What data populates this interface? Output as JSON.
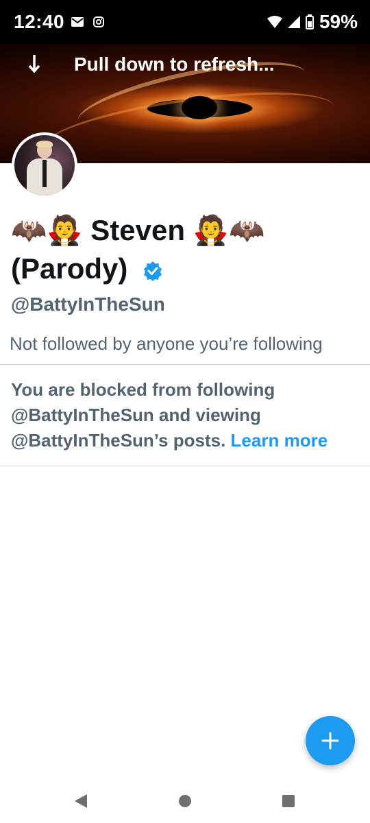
{
  "status_bar": {
    "time": "12:40",
    "battery_percent": "59%",
    "icons": [
      "mail-icon",
      "instagram-icon",
      "wifi-icon",
      "signal-icon",
      "battery-icon"
    ]
  },
  "banner": {
    "refresh_text": "Pull down to refresh..."
  },
  "profile": {
    "display_name": "🦇🧛 Steven 🧛🦇 (Parody)",
    "handle": "@BattyInTheSun",
    "followers_note": "Not followed by anyone you’re following",
    "verified": true
  },
  "blocked_notice": {
    "text": "You are blocked from following @BattyInTheSun and viewing @BattyInTheSun’s posts.",
    "learn_more": "Learn more"
  },
  "colors": {
    "accent": "#1d9bf0",
    "secondary_text": "#536471",
    "primary_text": "#0f1419"
  }
}
